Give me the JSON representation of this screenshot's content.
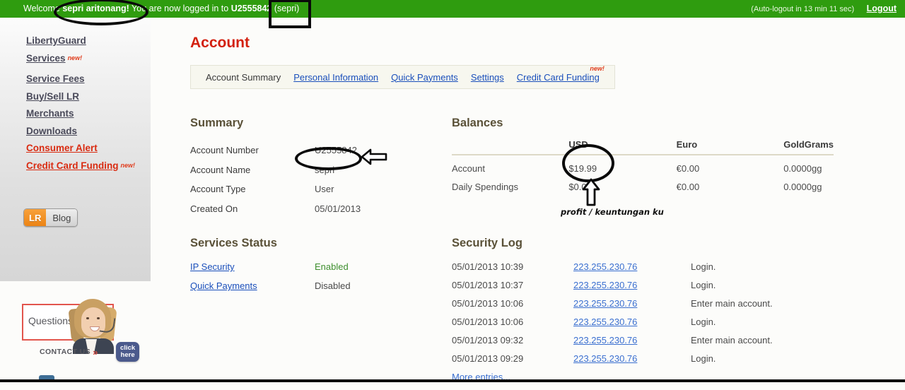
{
  "topbar": {
    "welcome_prefix": "Welcome ",
    "user_display_name": "sepri aritonang!",
    "welcome_middle": " You are now logged in to ",
    "account_id": "U2555842",
    "account_alias": "(sepri)",
    "autologout": "(Auto-logout in 13 min 11 sec)",
    "logout_label": "Logout",
    "bg_color": "#2f9c0f"
  },
  "sidebar": {
    "items": [
      {
        "label": "LibertyGuard",
        "new": "",
        "alert": false
      },
      {
        "label": "Services",
        "new": "new!",
        "alert": false
      },
      {
        "label": "Service Fees",
        "new": "",
        "alert": false
      },
      {
        "label": "Buy/Sell LR",
        "new": "",
        "alert": false
      },
      {
        "label": "Merchants",
        "new": "",
        "alert": false
      },
      {
        "label": "Downloads",
        "new": "",
        "alert": false
      },
      {
        "label": "Consumer Alert",
        "new": "",
        "alert": true
      },
      {
        "label": "Credit Card Funding",
        "new": "new!",
        "alert": true
      }
    ],
    "blog_button": {
      "brand": "LR",
      "label": "Blog"
    }
  },
  "contact_widget": {
    "question_text": "Questions?",
    "cta_text": "CONTACT US",
    "cta_chevron": "»",
    "click_line1": "click",
    "click_line2": "here",
    "border_color": "#e2554d",
    "pill_color": "#4b5a8c"
  },
  "main": {
    "page_title": "Account",
    "tabs": [
      {
        "label": "Account Summary",
        "active": true,
        "new": ""
      },
      {
        "label": "Personal Information",
        "active": false,
        "new": ""
      },
      {
        "label": "Quick Payments",
        "active": false,
        "new": ""
      },
      {
        "label": "Settings",
        "active": false,
        "new": ""
      },
      {
        "label": "Credit Card Funding",
        "active": false,
        "new": "new!"
      }
    ],
    "summary": {
      "title": "Summary",
      "rows": [
        {
          "key": "Account Number",
          "value": "U2555842"
        },
        {
          "key": "Account Name",
          "value": "sepri"
        },
        {
          "key": "Account Type",
          "value": "User"
        },
        {
          "key": "Created On",
          "value": "05/01/2013"
        }
      ]
    },
    "balances": {
      "title": "Balances",
      "headers": [
        "",
        "USD",
        "Euro",
        "GoldGrams"
      ],
      "rows": [
        {
          "label": "Account",
          "usd": "$19.99",
          "eur": "€0.00",
          "gg": "0.0000gg"
        },
        {
          "label": "Daily Spendings",
          "usd": "$0.00",
          "eur": "€0.00",
          "gg": "0.0000gg"
        }
      ]
    },
    "services_status": {
      "title": "Services Status",
      "rows": [
        {
          "name": "IP Security",
          "status": "Enabled",
          "state": "enabled"
        },
        {
          "name": "Quick Payments",
          "status": "Disabled",
          "state": "disabled"
        }
      ]
    },
    "security_log": {
      "title": "Security Log",
      "rows": [
        {
          "timestamp": "05/01/2013 10:39",
          "ip": "223.255.230.76",
          "action": "Login."
        },
        {
          "timestamp": "05/01/2013 10:37",
          "ip": "223.255.230.76",
          "action": "Login."
        },
        {
          "timestamp": "05/01/2013 10:06",
          "ip": "223.255.230.76",
          "action": "Enter main account."
        },
        {
          "timestamp": "05/01/2013 10:06",
          "ip": "223.255.230.76",
          "action": "Login."
        },
        {
          "timestamp": "05/01/2013 09:32",
          "ip": "223.255.230.76",
          "action": "Enter main account."
        },
        {
          "timestamp": "05/01/2013 09:29",
          "ip": "223.255.230.76",
          "action": "Login."
        }
      ],
      "more_label": "More entries..."
    }
  },
  "annotations": {
    "balance_note": "profit / keuntungan ku"
  }
}
